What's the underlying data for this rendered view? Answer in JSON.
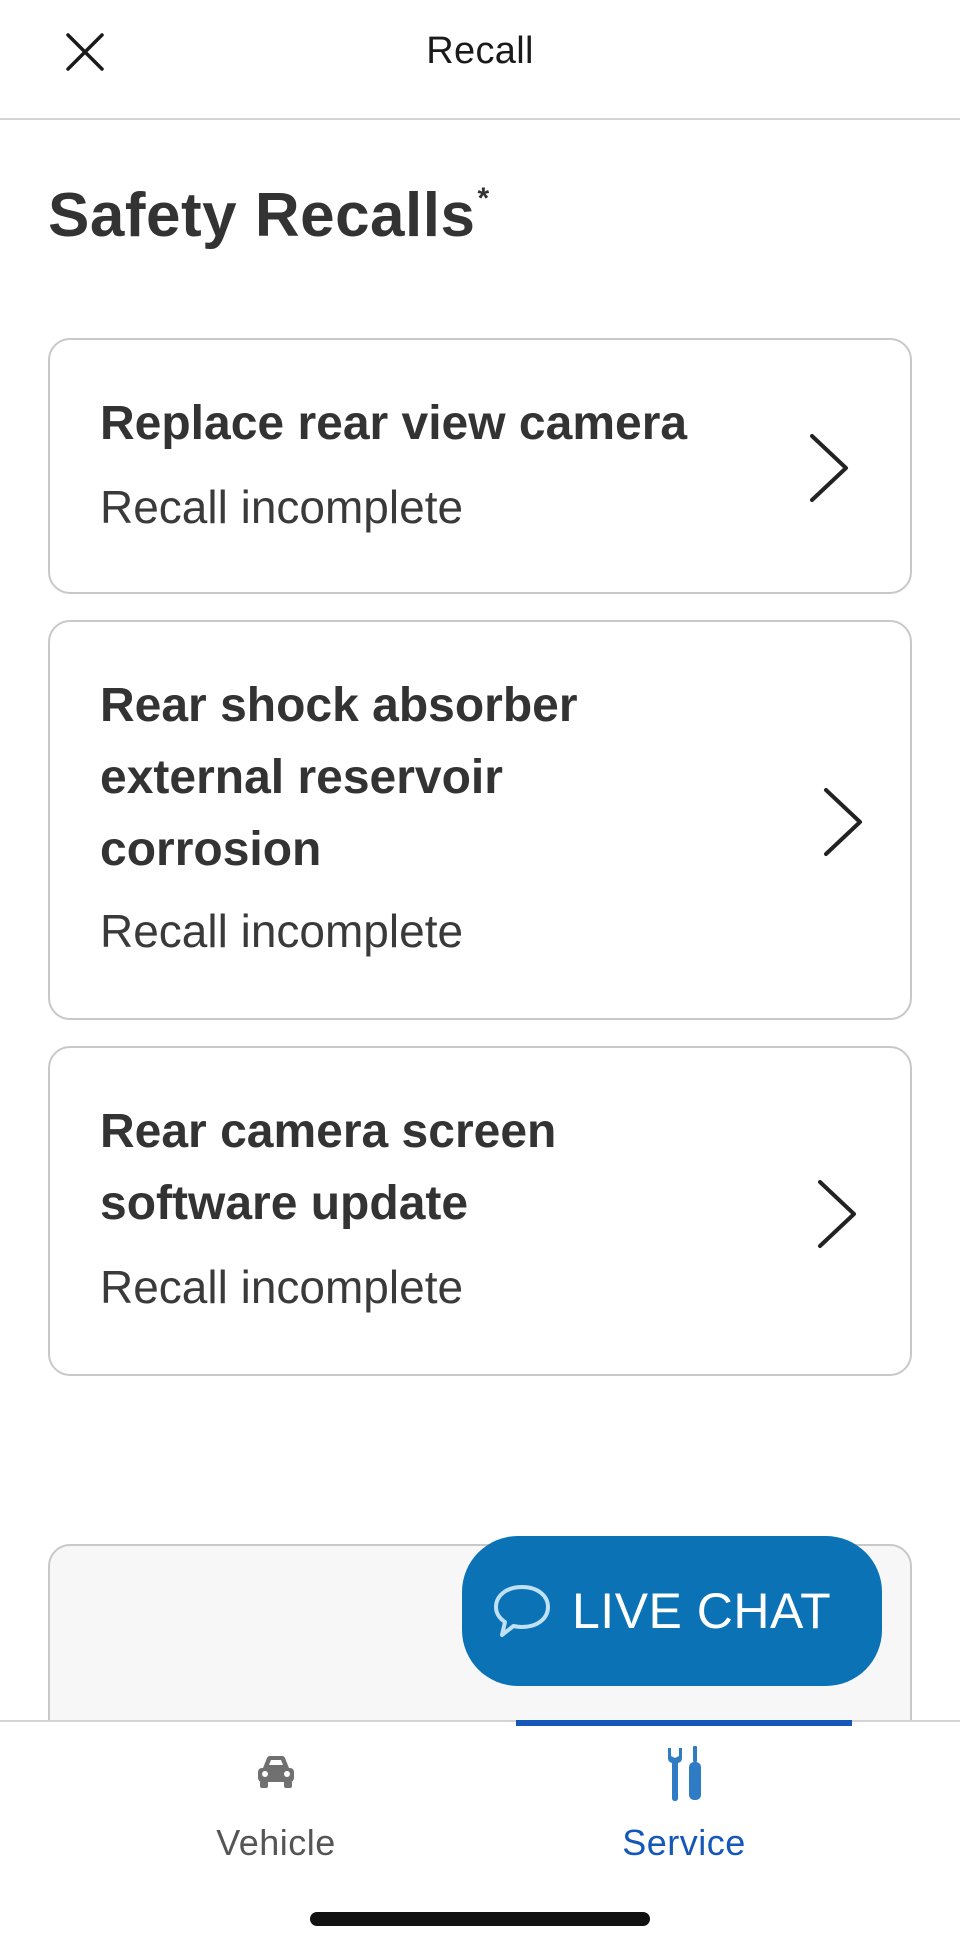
{
  "header": {
    "title": "Recall",
    "close_icon": "close-icon"
  },
  "section": {
    "title": "Safety Recalls",
    "title_mark": "*"
  },
  "recalls": [
    {
      "title": "Replace rear view camera",
      "status": "Recall incomplete"
    },
    {
      "title": "Rear shock absorber external reservoir corrosion",
      "status": "Recall incomplete"
    },
    {
      "title": "Rear camera screen software update",
      "status": "Recall incomplete"
    }
  ],
  "live_chat": {
    "label": "LIVE CHAT",
    "icon": "chat-bubble-icon",
    "color": "#0a72b5"
  },
  "bottom_nav": {
    "items": [
      {
        "label": "Vehicle",
        "icon": "car-icon",
        "active": false
      },
      {
        "label": "Service",
        "icon": "tools-icon",
        "active": true
      }
    ],
    "active_color": "#1457b8",
    "inactive_color": "#555555"
  }
}
